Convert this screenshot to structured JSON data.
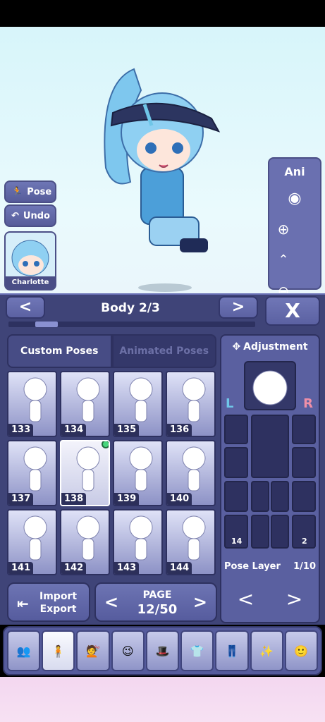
{
  "left_buttons": {
    "pose": "Pose",
    "undo": "Undo"
  },
  "character": {
    "name": "Charlotte"
  },
  "right_panel": {
    "ani": "Ani"
  },
  "header": {
    "title": "Body 2/3",
    "prev": "<",
    "next": ">",
    "close": "X"
  },
  "tabs": {
    "custom": "Custom Poses",
    "animated": "Animated Poses"
  },
  "poses": [
    {
      "num": "133"
    },
    {
      "num": "134"
    },
    {
      "num": "135"
    },
    {
      "num": "136"
    },
    {
      "num": "137"
    },
    {
      "num": "138"
    },
    {
      "num": "139"
    },
    {
      "num": "140"
    },
    {
      "num": "141"
    },
    {
      "num": "142"
    },
    {
      "num": "143"
    },
    {
      "num": "144"
    }
  ],
  "selected_pose": "138",
  "import_export": {
    "line1": "Import",
    "line2": "Export"
  },
  "page": {
    "label": "PAGE",
    "value": "12/50",
    "prev": "<",
    "next": ">"
  },
  "adjustment": {
    "title": "Adjustment",
    "left": "L",
    "right": "R",
    "left_count": "14",
    "right_count": "2",
    "pose_layer_label": "Pose Layer",
    "pose_layer_value": "1/10",
    "prev": "<",
    "next": ">"
  },
  "colors": {
    "panel": "#3f4478",
    "accent_green": "#47d67c",
    "left_blue": "#6fc6e8",
    "right_pink": "#ef8fa8"
  },
  "categories": [
    "characters-icon",
    "pose-figure-icon",
    "hair-icon",
    "face-icon",
    "accessories-icon",
    "shirt-icon",
    "pants-icon",
    "effects-icon",
    "profile-icon"
  ]
}
